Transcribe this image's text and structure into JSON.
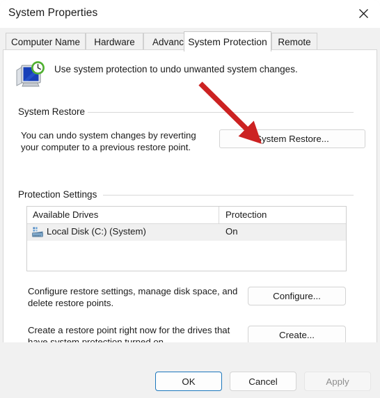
{
  "window": {
    "title": "System Properties",
    "close_icon": "close-icon"
  },
  "tabs": [
    {
      "label": "Computer Name",
      "active": false
    },
    {
      "label": "Hardware",
      "active": false
    },
    {
      "label": "Advanced",
      "active": false
    },
    {
      "label": "System Protection",
      "active": true
    },
    {
      "label": "Remote",
      "active": false
    }
  ],
  "header": {
    "icon": "system-protection-icon",
    "text": "Use system protection to undo unwanted system changes."
  },
  "system_restore": {
    "group_label": "System Restore",
    "description": "You can undo system changes by reverting your computer to a previous restore point.",
    "button_label": "System Restore..."
  },
  "protection_settings": {
    "group_label": "Protection Settings",
    "table": {
      "columns": [
        "Available Drives",
        "Protection"
      ],
      "rows": [
        {
          "drive_icon": "hard-drive-icon",
          "drive": "Local Disk (C:) (System)",
          "protection": "On"
        }
      ]
    },
    "configure": {
      "description": "Configure restore settings, manage disk space, and delete restore points.",
      "button_label": "Configure..."
    },
    "create": {
      "description": "Create a restore point right now for the drives that have system protection turned on.",
      "button_label": "Create..."
    }
  },
  "footer": {
    "ok_label": "OK",
    "cancel_label": "Cancel",
    "apply_label": "Apply",
    "apply_disabled": true
  },
  "annotation": {
    "type": "arrow",
    "color": "#cc2222",
    "points_to": "System Restore..."
  }
}
